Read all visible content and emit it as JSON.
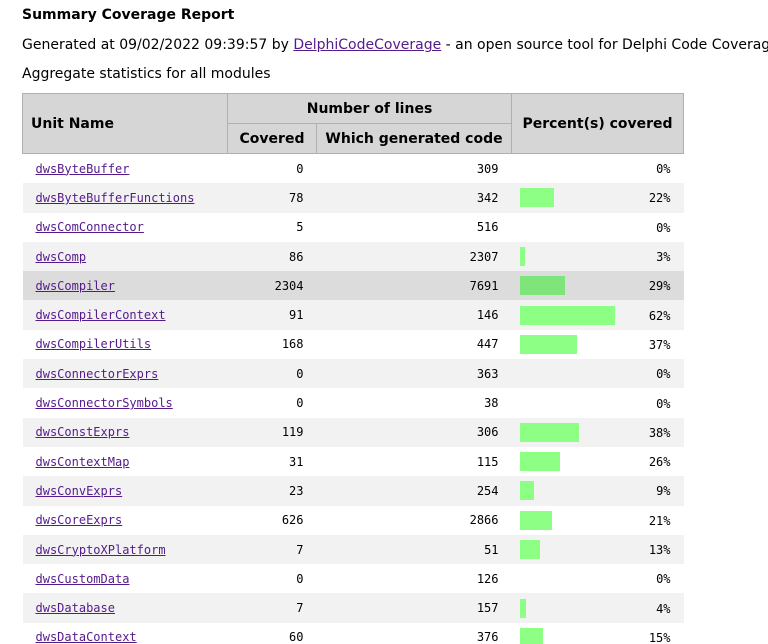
{
  "report": {
    "title": "Summary Coverage Report",
    "generated_prefix": "Generated at 09/02/2022 09:39:57 by ",
    "tool_link": "DelphiCodeCoverage",
    "generated_suffix": " - an open source tool for Delphi Code Coverage.",
    "aggregate_label": "Aggregate statistics for all modules"
  },
  "table": {
    "headers": {
      "unit_name": "Unit Name",
      "number_of_lines": "Number of lines",
      "covered": "Covered",
      "which_generated_code": "Which generated code",
      "percent_covered": "Percent(s) covered"
    },
    "rows": [
      {
        "unit": "dwsByteBuffer",
        "covered": "0",
        "generated": "309",
        "percent_label": "0%",
        "percent": 0
      },
      {
        "unit": "dwsByteBufferFunctions",
        "covered": "78",
        "generated": "342",
        "percent_label": "22%",
        "percent": 22
      },
      {
        "unit": "dwsComConnector",
        "covered": "5",
        "generated": "516",
        "percent_label": "0%",
        "percent": 0
      },
      {
        "unit": "dwsComp",
        "covered": "86",
        "generated": "2307",
        "percent_label": "3%",
        "percent": 3
      },
      {
        "unit": "dwsCompiler",
        "covered": "2304",
        "generated": "7691",
        "percent_label": "29%",
        "percent": 29
      },
      {
        "unit": "dwsCompilerContext",
        "covered": "91",
        "generated": "146",
        "percent_label": "62%",
        "percent": 62
      },
      {
        "unit": "dwsCompilerUtils",
        "covered": "168",
        "generated": "447",
        "percent_label": "37%",
        "percent": 37
      },
      {
        "unit": "dwsConnectorExprs",
        "covered": "0",
        "generated": "363",
        "percent_label": "0%",
        "percent": 0
      },
      {
        "unit": "dwsConnectorSymbols",
        "covered": "0",
        "generated": "38",
        "percent_label": "0%",
        "percent": 0
      },
      {
        "unit": "dwsConstExprs",
        "covered": "119",
        "generated": "306",
        "percent_label": "38%",
        "percent": 38
      },
      {
        "unit": "dwsContextMap",
        "covered": "31",
        "generated": "115",
        "percent_label": "26%",
        "percent": 26
      },
      {
        "unit": "dwsConvExprs",
        "covered": "23",
        "generated": "254",
        "percent_label": "9%",
        "percent": 9
      },
      {
        "unit": "dwsCoreExprs",
        "covered": "626",
        "generated": "2866",
        "percent_label": "21%",
        "percent": 21
      },
      {
        "unit": "dwsCryptoXPlatform",
        "covered": "7",
        "generated": "51",
        "percent_label": "13%",
        "percent": 13
      },
      {
        "unit": "dwsCustomData",
        "covered": "0",
        "generated": "126",
        "percent_label": "0%",
        "percent": 0
      },
      {
        "unit": "dwsDatabase",
        "covered": "7",
        "generated": "157",
        "percent_label": "4%",
        "percent": 4
      },
      {
        "unit": "dwsDataContext",
        "covered": "60",
        "generated": "376",
        "percent_label": "15%",
        "percent": 15
      }
    ],
    "hover_row_index": 4
  },
  "colors": {
    "bar": "#8cff84",
    "header_bg": "#d6d6d6",
    "link": "#551a8b"
  }
}
